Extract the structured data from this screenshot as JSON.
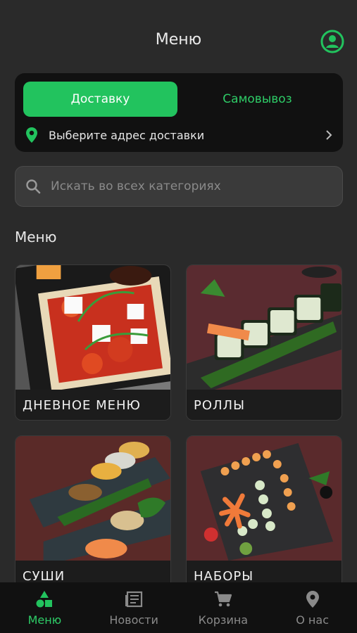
{
  "header": {
    "title": "Меню"
  },
  "delivery": {
    "tab_delivery": "Доставку",
    "tab_pickup": "Самовывоз",
    "address_label": "Выберите адрес доставки"
  },
  "search": {
    "placeholder": "Искать во всех категориях"
  },
  "section": {
    "title": "Меню"
  },
  "categories": [
    {
      "label": "ДНЕВНОЕ МЕНЮ"
    },
    {
      "label": "РОЛЛЫ"
    },
    {
      "label": "СУШИ"
    },
    {
      "label": "НАБОРЫ"
    }
  ],
  "nav": [
    {
      "label": "Меню",
      "icon": "shapes-icon",
      "active": true
    },
    {
      "label": "Новости",
      "icon": "news-icon",
      "active": false
    },
    {
      "label": "Корзина",
      "icon": "cart-icon",
      "active": false
    },
    {
      "label": "О нас",
      "icon": "location-icon",
      "active": false
    }
  ],
  "colors": {
    "accent": "#22c35e",
    "background": "#2a2a2a",
    "card": "#111111"
  }
}
